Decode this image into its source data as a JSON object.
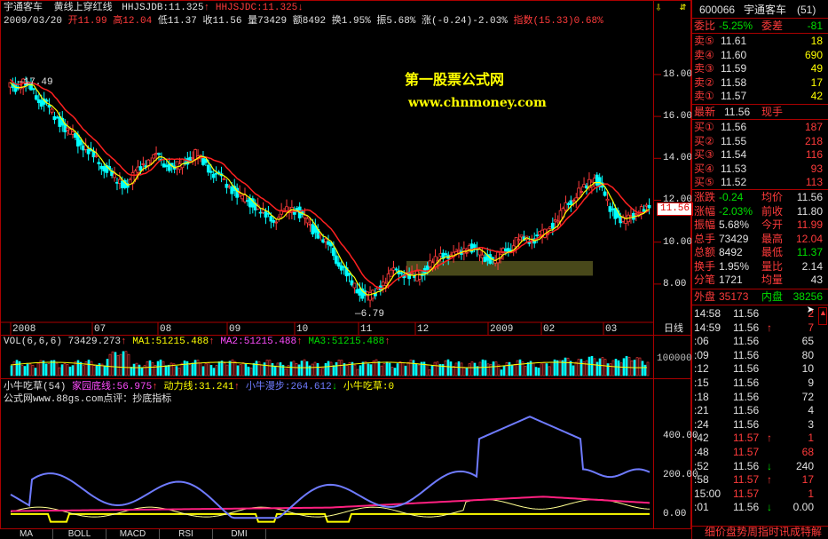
{
  "main_title": {
    "stock": "宇通客车",
    "indicator": "黄线上穿红线",
    "hhjsjdb": "HHJSJDB:11.325",
    "hhjsjdc": "HHJSJDC:11.325",
    "up_arrow": "↑",
    "down_arrow": "↓"
  },
  "info_line": {
    "date": "2009/03/20",
    "open_label": "开",
    "open": "11.99",
    "high_label": "高",
    "high": "12.04",
    "low_label": "低",
    "low": "11.37",
    "close_label": "收",
    "close": "11.56",
    "vol_label": "量",
    "vol": "73429",
    "amt_label": "额",
    "amt": "8492",
    "turn_label": "换",
    "turn": "1.95%",
    "amp_label": "振",
    "amp": "5.68%",
    "chg_label": "涨",
    "chg": "(-0.24)-2.03%",
    "idx_label": "指数",
    "idx": "(15.33)0.68%"
  },
  "watermark": {
    "title": "第一股票公式网",
    "url": "www.chnmoney.com"
  },
  "price_axis": [
    "18.00",
    "16.00",
    "14.00",
    "12.00",
    "10.00",
    "8.00"
  ],
  "price_tag": "11.56",
  "marks": {
    "high": "17.49",
    "low": "6.79"
  },
  "months": [
    "2008",
    "07",
    "08",
    "09",
    "10",
    "11",
    "12",
    "2009",
    "02",
    "03"
  ],
  "period_label": "日线",
  "vol_line": {
    "label": "VOL(6,6,6)",
    "value": "73429.273",
    "ma1": "MA1:51215.488",
    "ma2": "MA2:51215.488",
    "ma3": "MA3:51215.488",
    "arrow": "↑",
    "axis": "100000"
  },
  "ind_line": {
    "name": "小牛吃草(54)",
    "l1": "家园底线:56.975",
    "l2": "动力线:31.241",
    "l3": "小牛漫步:264.612",
    "l4": "小牛吃草:0",
    "arrow_up": "↑",
    "arrow_down": "↓",
    "note": "公式网www.88gs.com点评：抄底指标",
    "axis": [
      "400.00",
      "200.00",
      "0.00"
    ]
  },
  "tabs": [
    "MA",
    "BOLL",
    "MACD",
    "RSI",
    "DMI"
  ],
  "right_panel": {
    "code": "600066",
    "name": "宇通客车",
    "num": "(51)",
    "weibi_label": "委比",
    "weibi": "-5.25%",
    "weicha_label": "委差",
    "weicha": "-81",
    "sells": [
      {
        "label": "卖⑤",
        "price": "11.61",
        "vol": "18"
      },
      {
        "label": "卖④",
        "price": "11.60",
        "vol": "690"
      },
      {
        "label": "卖③",
        "price": "11.59",
        "vol": "49"
      },
      {
        "label": "卖②",
        "price": "11.58",
        "vol": "17"
      },
      {
        "label": "卖①",
        "price": "11.57",
        "vol": "42"
      }
    ],
    "latest_label": "最新",
    "latest": "11.56",
    "xianshou": "现手",
    "buys": [
      {
        "label": "买①",
        "price": "11.56",
        "vol": "187"
      },
      {
        "label": "买②",
        "price": "11.55",
        "vol": "218"
      },
      {
        "label": "买③",
        "price": "11.54",
        "vol": "116"
      },
      {
        "label": "买④",
        "price": "11.53",
        "vol": "93"
      },
      {
        "label": "买⑤",
        "price": "11.52",
        "vol": "113"
      }
    ],
    "stats": [
      {
        "l1": "涨跌",
        "v1": "-0.24",
        "l2": "均价",
        "v2": "11.56",
        "c1": "#00e000",
        "c2": "#e0e0e0"
      },
      {
        "l1": "涨幅",
        "v1": "-2.03%",
        "l2": "前收",
        "v2": "11.80",
        "c1": "#00e000",
        "c2": "#e0e0e0"
      },
      {
        "l1": "振幅",
        "v1": "5.68%",
        "l2": "今开",
        "v2": "11.99",
        "c1": "#e0e0e0",
        "c2": "#ff3b3b"
      },
      {
        "l1": "总手",
        "v1": "73429",
        "l2": "最高",
        "v2": "12.04",
        "c1": "#e0e0e0",
        "c2": "#ff3b3b"
      },
      {
        "l1": "总额",
        "v1": "8492",
        "l2": "最低",
        "v2": "11.37",
        "c1": "#e0e0e0",
        "c2": "#00e000"
      },
      {
        "l1": "换手",
        "v1": "1.95%",
        "l2": "量比",
        "v2": "2.14",
        "c1": "#e0e0e0",
        "c2": "#e0e0e0"
      },
      {
        "l1": "分笔",
        "v1": "1721",
        "l2": "均量",
        "v2": "43",
        "c1": "#e0e0e0",
        "c2": "#e0e0e0"
      }
    ],
    "waipan_label": "外盘",
    "waipan": "35173",
    "neipan_label": "内盘",
    "neipan": "38256",
    "ticks": [
      {
        "t": "14:58",
        "p": "11.56",
        "a": "",
        "v": "2",
        "pc": "#e0e0e0",
        "vc": "#ff3b3b"
      },
      {
        "t": "14:59",
        "p": "11.56",
        "a": "↑",
        "v": "7",
        "pc": "#e0e0e0",
        "vc": "#ff3b3b"
      },
      {
        "t": ":06",
        "p": "11.56",
        "a": "",
        "v": "65",
        "pc": "#e0e0e0",
        "vc": "#e0e0e0"
      },
      {
        "t": ":09",
        "p": "11.56",
        "a": "",
        "v": "80",
        "pc": "#e0e0e0",
        "vc": "#e0e0e0"
      },
      {
        "t": ":12",
        "p": "11.56",
        "a": "",
        "v": "10",
        "pc": "#e0e0e0",
        "vc": "#e0e0e0"
      },
      {
        "t": ":15",
        "p": "11.56",
        "a": "",
        "v": "9",
        "pc": "#e0e0e0",
        "vc": "#e0e0e0"
      },
      {
        "t": ":18",
        "p": "11.56",
        "a": "",
        "v": "72",
        "pc": "#e0e0e0",
        "vc": "#e0e0e0"
      },
      {
        "t": ":21",
        "p": "11.56",
        "a": "",
        "v": "4",
        "pc": "#e0e0e0",
        "vc": "#e0e0e0"
      },
      {
        "t": ":24",
        "p": "11.56",
        "a": "",
        "v": "3",
        "pc": "#e0e0e0",
        "vc": "#e0e0e0"
      },
      {
        "t": ":42",
        "p": "11.57",
        "a": "↑",
        "v": "1",
        "pc": "#ff3b3b",
        "vc": "#ff3b3b"
      },
      {
        "t": ":48",
        "p": "11.57",
        "a": "",
        "v": "68",
        "pc": "#ff3b3b",
        "vc": "#ff3b3b"
      },
      {
        "t": ":52",
        "p": "11.56",
        "a": "↓",
        "v": "240",
        "pc": "#e0e0e0",
        "vc": "#e0e0e0"
      },
      {
        "t": ":58",
        "p": "11.57",
        "a": "↑",
        "v": "17",
        "pc": "#ff3b3b",
        "vc": "#ff3b3b"
      },
      {
        "t": "15:00",
        "p": "11.57",
        "a": "",
        "v": "1",
        "pc": "#ff3b3b",
        "vc": "#ff3b3b"
      },
      {
        "t": ":01",
        "p": "11.56",
        "a": "↓",
        "v": "0.00",
        "pc": "#e0e0e0",
        "vc": "#e0e0e0"
      }
    ],
    "bottom_text": "细价盘势周指时讯成特解"
  },
  "chart_data": {
    "type": "candlestick",
    "price_axis_ticks": [
      8,
      10,
      12,
      14,
      16,
      18
    ],
    "price_range": [
      6.3,
      20.2
    ],
    "candles": [
      17.4,
      17.6,
      17.3,
      16.8,
      16.5,
      16.0,
      15.6,
      15.2,
      14.8,
      14.5,
      14.0,
      13.7,
      13.3,
      12.9,
      12.7,
      13.1,
      13.6,
      13.9,
      14.1,
      13.8,
      13.5,
      13.7,
      13.9,
      14.2,
      13.8,
      13.4,
      13.1,
      12.8,
      12.4,
      12.1,
      11.9,
      11.6,
      11.2,
      11.1,
      11.3,
      11.6,
      11.5,
      11.1,
      10.6,
      10.3,
      9.8,
      9.2,
      8.6,
      8.0,
      7.6,
      7.4,
      7.6,
      8.1,
      8.5,
      8.7,
      8.4,
      8.3,
      8.6,
      8.9,
      9.2,
      9.5,
      9.3,
      9.6,
      9.8,
      9.5,
      9.3,
      9.1,
      9.4,
      9.7,
      10.0,
      10.2,
      10.1,
      10.3,
      10.6,
      11.0,
      11.5,
      12.0,
      12.4,
      12.6,
      13.2,
      12.4,
      11.6,
      11.2,
      11.0,
      11.3,
      11.6,
      11.56
    ],
    "vol_axis_ticks": [
      100000
    ],
    "ind_axis_ticks": [
      0,
      200,
      400
    ],
    "ind_range": [
      -60,
      560
    ]
  }
}
